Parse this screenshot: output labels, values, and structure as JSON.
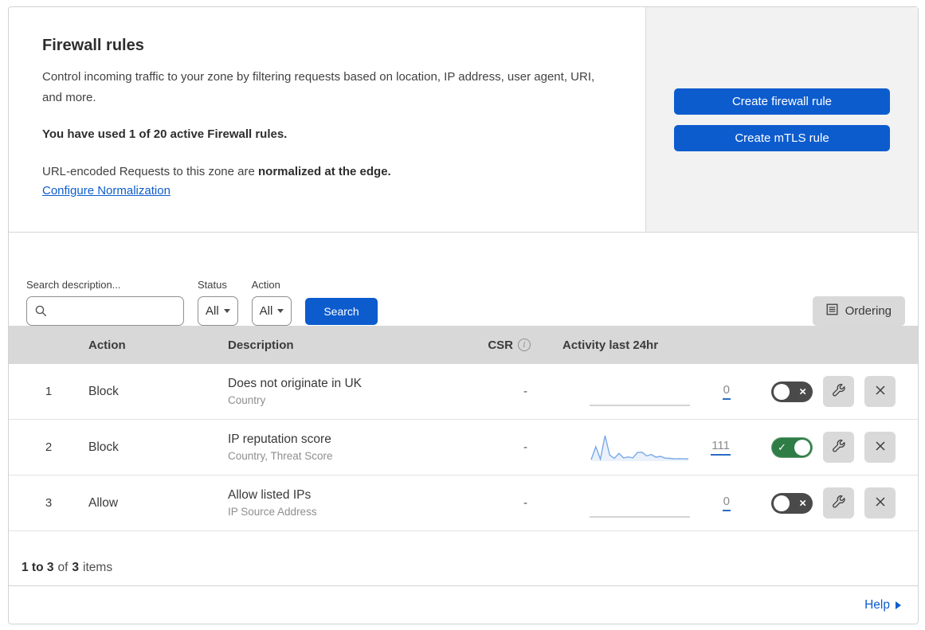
{
  "colors": {
    "accent_blue": "#0d5cce",
    "toggle_on_green": "#2e7d46",
    "toggle_off_gray": "#4a4a4a",
    "sparkline_line": "#78a9e8",
    "sparkline_fill": "#eaf1fb",
    "flatline_gray": "#c6c6c6"
  },
  "icons": {
    "toggle_on_check": "✓",
    "toggle_off_x": "×",
    "info": "i"
  },
  "intro": {
    "title": "Firewall rules",
    "description": "Control incoming traffic to your zone by filtering requests based on location, IP address, user agent, URI, and more.",
    "usage": "You have used 1 of 20 active Firewall rules.",
    "normalization_prefix": "URL-encoded Requests to this zone are ",
    "normalization_bold": "normalized at the edge.",
    "normalization_link": "Configure Normalization"
  },
  "actions_panel": {
    "create_firewall_rule": "Create firewall rule",
    "create_mtls_rule": "Create mTLS rule"
  },
  "filters": {
    "search_label": "Search description...",
    "status_label": "Status",
    "status_value": "All",
    "action_label": "Action",
    "action_value": "All",
    "search_button": "Search",
    "ordering_button": "Ordering"
  },
  "table": {
    "headers": {
      "action": "Action",
      "description": "Description",
      "csr": "CSR",
      "activity": "Activity last 24hr"
    },
    "rows": [
      {
        "num": "1",
        "action": "Block",
        "description": "Does not originate in UK",
        "fields": "Country",
        "csr": "-",
        "count": "0",
        "enabled": false,
        "sparkline": null
      },
      {
        "num": "2",
        "action": "Block",
        "description": "IP reputation score",
        "fields": "Country, Threat Score",
        "csr": "-",
        "count": "111",
        "enabled": true,
        "sparkline": [
          3,
          55,
          5,
          100,
          22,
          8,
          28,
          10,
          14,
          10,
          32,
          33,
          18,
          24,
          13,
          16,
          9,
          8,
          6,
          7,
          6,
          6
        ]
      },
      {
        "num": "3",
        "action": "Allow",
        "description": "Allow listed IPs",
        "fields": "IP Source Address",
        "csr": "-",
        "count": "0",
        "enabled": false,
        "sparkline": null
      }
    ]
  },
  "footer": {
    "range": "1 to 3",
    "of": "of",
    "total": "3",
    "items": "items"
  },
  "help": {
    "label": "Help"
  }
}
